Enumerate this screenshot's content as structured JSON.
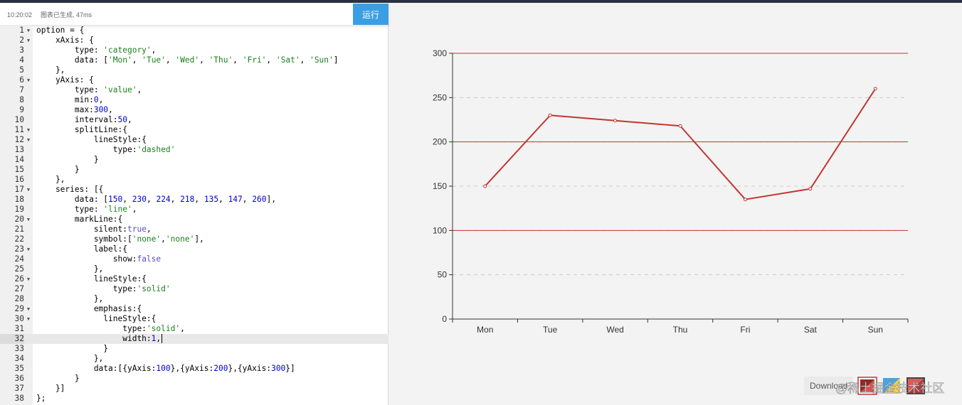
{
  "toolbar": {
    "time": "10:20:02",
    "message": "图表已生成, 47ms",
    "run_label": "运行"
  },
  "editor": {
    "lines": [
      "option = {",
      "    xAxis: {",
      "        type: 'category',",
      "        data: ['Mon', 'Tue', 'Wed', 'Thu', 'Fri', 'Sat', 'Sun']",
      "    },",
      "    yAxis: {",
      "        type: 'value',",
      "        min:0,",
      "        max:300,",
      "        interval:50,",
      "        splitLine:{",
      "            lineStyle:{",
      "                type:'dashed'",
      "            }",
      "        }",
      "    },",
      "    series: [{",
      "        data: [150, 230, 224, 218, 135, 147, 260],",
      "        type: 'line',",
      "        markLine:{",
      "            silent:true,",
      "            symbol:['none','none'],",
      "            label:{",
      "                show:false",
      "            },",
      "            lineStyle:{",
      "                type:'solid'",
      "            },",
      "            emphasis:{",
      "              lineStyle:{",
      "                  type:'solid',",
      "                  width:1,",
      "              }",
      "            },",
      "            data:[{yAxis:100},{yAxis:200},{yAxis:300}]",
      "        }",
      "    }]",
      "};"
    ],
    "fold_lines": [
      1,
      2,
      6,
      11,
      12,
      17,
      20,
      23,
      26,
      29,
      30
    ],
    "active_line": 32
  },
  "chart_data": {
    "type": "line",
    "categories": [
      "Mon",
      "Tue",
      "Wed",
      "Thu",
      "Fri",
      "Sat",
      "Sun"
    ],
    "series": [
      {
        "values": [
          150,
          230,
          224,
          218,
          135,
          147,
          260
        ]
      }
    ],
    "ylim": [
      0,
      300
    ],
    "y_ticks": [
      0,
      50,
      100,
      150,
      200,
      250,
      300
    ],
    "mark_lines": [
      100,
      200,
      300
    ],
    "grid": "dashed",
    "colors": {
      "series": "#c23531",
      "mark_line": "#c23531",
      "axis": "#333333",
      "split": "#cccccc"
    }
  },
  "toolbox": {
    "download_label": "Download",
    "watermark": "@稀土掘金技术社区"
  }
}
